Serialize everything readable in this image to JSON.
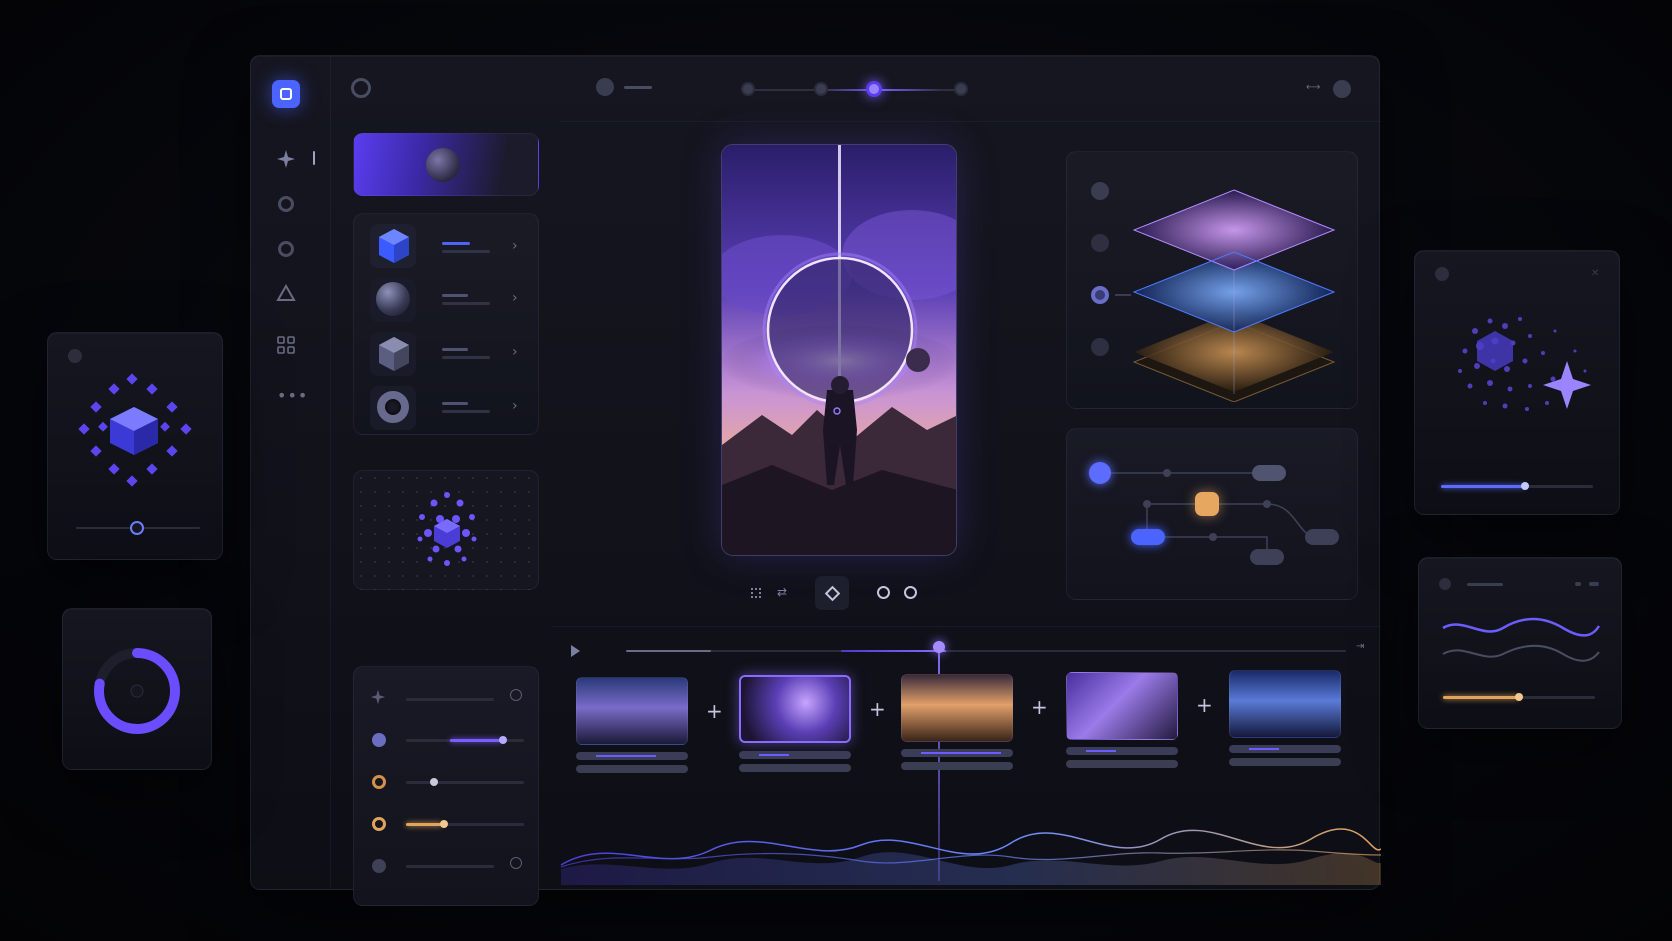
{
  "app": {
    "logo_icon": "rounded-square-icon",
    "accent": "#6b5cff",
    "accent_blue": "#4b63ff",
    "accent_orange": "#e0a45a"
  },
  "left_rail": {
    "items": [
      {
        "icon": "sparkle-icon"
      },
      {
        "icon": "circle-icon"
      },
      {
        "icon": "circle-icon"
      },
      {
        "icon": "triangle-icon"
      },
      {
        "icon": "grid-icon"
      },
      {
        "icon": "more-icon"
      }
    ]
  },
  "asset_list": {
    "items": [
      {
        "icon": "cube-icon",
        "selected": true
      },
      {
        "icon": "sphere-icon"
      },
      {
        "icon": "hexagon-icon"
      },
      {
        "icon": "torus-icon"
      }
    ]
  },
  "sliders": {
    "items": [
      {
        "icon": "sparkle-icon",
        "value": 0.0,
        "color": "#3a3c50"
      },
      {
        "icon": "moon-icon",
        "value": 0.8,
        "color": "#7b5cff"
      },
      {
        "icon": "sun-icon",
        "value": 0.25,
        "color": "#8a8ca6"
      },
      {
        "icon": "flower-icon",
        "value": 0.35,
        "color": "#e0a45a"
      },
      {
        "icon": "x-icon",
        "value": 0.0,
        "color": "#3a3c50"
      }
    ]
  },
  "top_bar": {
    "steps": 4,
    "active_step": 2
  },
  "timeline": {
    "progress": 0.49,
    "playhead": 0.47,
    "clips": [
      {
        "theme": "blue",
        "selected": false
      },
      {
        "theme": "violet",
        "selected": true
      },
      {
        "theme": "amber",
        "selected": false
      },
      {
        "theme": "violet",
        "selected": false
      },
      {
        "theme": "blue",
        "selected": false
      }
    ]
  },
  "layers_panel": {
    "active_index": 2
  },
  "right_panel": {
    "slider_value": 0.55,
    "wave_slider_value": 0.5
  },
  "donut": {
    "value": 0.78
  }
}
